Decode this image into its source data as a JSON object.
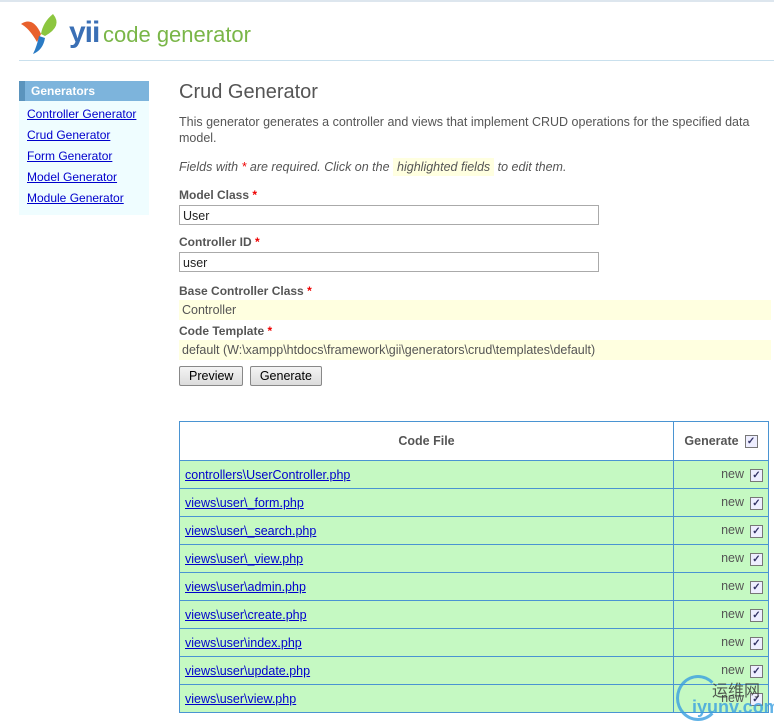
{
  "header": {
    "logo_text": "yii",
    "subtitle": "code generator"
  },
  "sidebar": {
    "title": "Generators",
    "items": [
      "Controller Generator",
      "Crud Generator",
      "Form Generator",
      "Model Generator",
      "Module Generator"
    ]
  },
  "main": {
    "title": "Crud Generator",
    "description": "This generator generates a controller and views that implement CRUD operations for the specified data model.",
    "note_prefix": "Fields with",
    "note_star": "*",
    "note_mid": "are required. Click on the",
    "note_highlight": "highlighted fields",
    "note_suffix": "to edit them.",
    "fields": [
      {
        "label": "Model Class",
        "value": "User"
      },
      {
        "label": "Controller ID",
        "value": "user"
      },
      {
        "label": "Base Controller Class",
        "value": "Controller"
      },
      {
        "label": "Code Template",
        "value": "default (W:\\xampp\\htdocs\\framework\\gii\\generators\\crud\\templates\\default)"
      }
    ],
    "required_mark": "*",
    "preview_label": "Preview",
    "generate_label": "Generate"
  },
  "table": {
    "col_file": "Code File",
    "col_generate": "Generate",
    "check": "✓",
    "rows": [
      {
        "file": "controllers\\UserController.php",
        "status": "new"
      },
      {
        "file": "views\\user\\_form.php",
        "status": "new"
      },
      {
        "file": "views\\user\\_search.php",
        "status": "new"
      },
      {
        "file": "views\\user\\_view.php",
        "status": "new"
      },
      {
        "file": "views\\user\\admin.php",
        "status": "new"
      },
      {
        "file": "views\\user\\create.php",
        "status": "new"
      },
      {
        "file": "views\\user\\index.php",
        "status": "new"
      },
      {
        "file": "views\\user\\update.php",
        "status": "new"
      },
      {
        "file": "views\\user\\view.php",
        "status": "new"
      }
    ]
  },
  "watermark": {
    "cn": "运维网",
    "domain": "iyunv.com"
  }
}
